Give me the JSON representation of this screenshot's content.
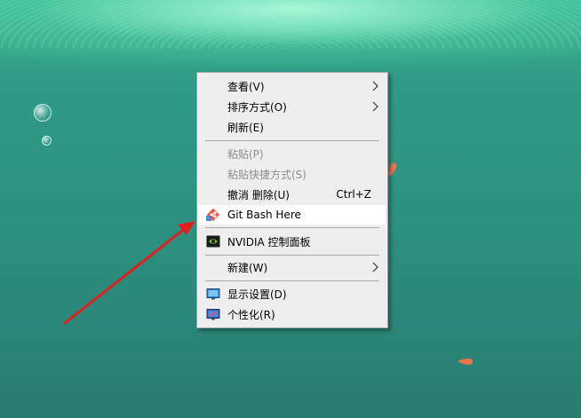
{
  "menu": {
    "items": [
      {
        "label": "查看(V)",
        "shortcut": "",
        "submenu": true,
        "disabled": false
      },
      {
        "label": "排序方式(O)",
        "shortcut": "",
        "submenu": true,
        "disabled": false
      },
      {
        "label": "刷新(E)",
        "shortcut": "",
        "submenu": false,
        "disabled": false
      },
      {
        "label": "粘贴(P)",
        "shortcut": "",
        "submenu": false,
        "disabled": true
      },
      {
        "label": "粘贴快捷方式(S)",
        "shortcut": "",
        "submenu": false,
        "disabled": true
      },
      {
        "label": "撤消 删除(U)",
        "shortcut": "Ctrl+Z",
        "submenu": false,
        "disabled": false
      },
      {
        "label": "Git Bash Here",
        "shortcut": "",
        "submenu": false,
        "disabled": false,
        "icon": "git-icon",
        "highlighted": true
      },
      {
        "label": "NVIDIA 控制面板",
        "shortcut": "",
        "submenu": false,
        "disabled": false,
        "icon": "nvidia-icon"
      },
      {
        "label": "新建(W)",
        "shortcut": "",
        "submenu": true,
        "disabled": false
      },
      {
        "label": "显示设置(D)",
        "shortcut": "",
        "submenu": false,
        "disabled": false,
        "icon": "display-settings-icon"
      },
      {
        "label": "个性化(R)",
        "shortcut": "",
        "submenu": false,
        "disabled": false,
        "icon": "personalize-icon"
      }
    ]
  },
  "colors": {
    "menu_background": "#eeeeee",
    "highlight": "#ffffff",
    "disabled_text": "#8d8d8d",
    "annotation_arrow": "#e02020",
    "git_brand": "#f05133",
    "nvidia_brand": "#76b900"
  }
}
